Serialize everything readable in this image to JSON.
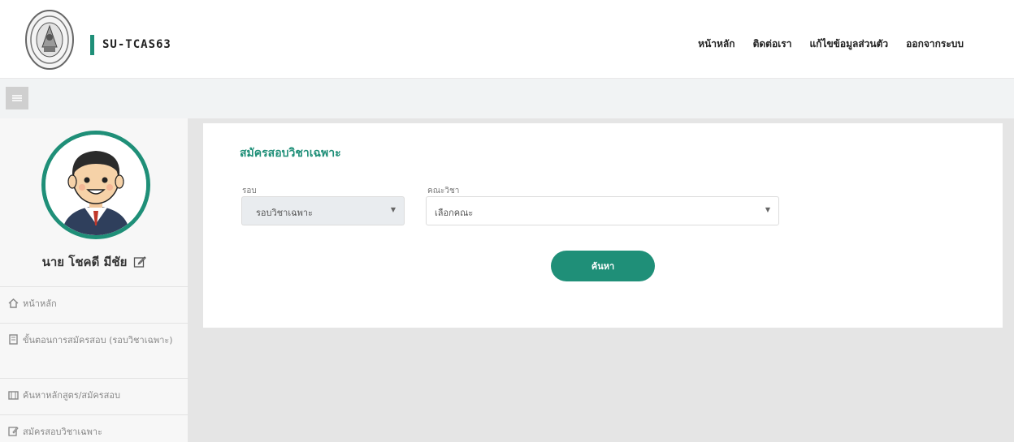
{
  "brand": {
    "name": "SU-TCAS63"
  },
  "top_nav": [
    "หน้าหลัก",
    "ติดต่อเรา",
    "แก้ไขข้อมูลส่วนตัว",
    "ออกจากระบบ"
  ],
  "sidebar": {
    "user_name": "นาย โชคดี มีชัย",
    "menu": [
      {
        "label": "หน้าหลัก",
        "icon": "home-icon"
      },
      {
        "label": "ขั้นตอนการสมัครสอบ (รอบวิชาเฉพาะ)",
        "icon": "book-icon"
      },
      {
        "label": "ค้นหาหลักสูตร/สมัครสอบ",
        "icon": "building-icon"
      },
      {
        "label": "สมัครสอบวิชาเฉพาะ",
        "icon": "edit-icon"
      }
    ]
  },
  "main": {
    "title": "สมัครสอบวิชาเฉพาะ",
    "round": {
      "label": "รอบ",
      "value": "รอบวิชาเฉพาะ"
    },
    "faculty": {
      "label": "คณะวิชา",
      "value": "เลือกคณะ"
    },
    "search_button": "ค้นหา"
  },
  "colors": {
    "accent": "#1f8f78",
    "page_bg": "#e5e5e5",
    "toolbar_bg": "#f1f3f4"
  }
}
